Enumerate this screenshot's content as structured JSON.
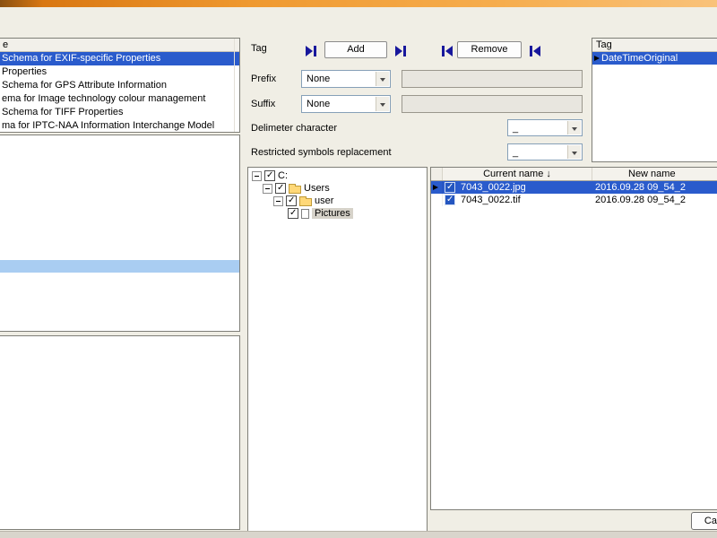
{
  "schema_panel": {
    "header": "e",
    "items": [
      "Schema for EXIF-specific Properties",
      "Properties",
      "Schema for GPS Attribute Information",
      "ema for Image technology colour management",
      "Schema for TIFF Properties",
      "ma for IPTC-NAA Information Interchange Model"
    ]
  },
  "controls": {
    "tag_label": "Tag",
    "add_button": "Add",
    "remove_button": "Remove",
    "prefix_label": "Prefix",
    "prefix_value": "None",
    "suffix_label": "Suffix",
    "suffix_value": "None",
    "delimiter_label": "Delimeter character",
    "delimiter_value": "_",
    "restricted_label": "Restricted symbols replacement",
    "restricted_value": "_"
  },
  "tag_list": {
    "header": "Tag",
    "rows": [
      "DateTimeOriginal"
    ]
  },
  "folder_tree": {
    "nodes": [
      {
        "label": "C:"
      },
      {
        "label": "Users"
      },
      {
        "label": "user"
      },
      {
        "label": "Pictures"
      }
    ]
  },
  "file_list": {
    "columns": {
      "current": "Current name",
      "new": "New name"
    },
    "sort_icon": "↓",
    "rows": [
      {
        "current": "7043_0022.jpg",
        "new": "2016.09.28 09_54_2"
      },
      {
        "current": "7043_0022.tif",
        "new": "2016.09.28 09_54_2"
      }
    ]
  },
  "footer": {
    "cancel_button": "Cancel"
  },
  "colors": {
    "selection_blue": "#2a5bcc",
    "light_selection_blue": "#a9cdf2",
    "titlebar_orange": "#ef9930"
  }
}
